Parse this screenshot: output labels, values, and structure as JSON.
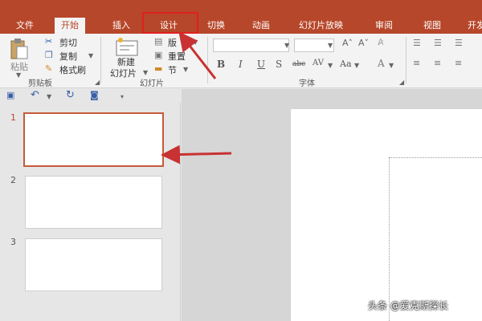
{
  "tabs": [
    {
      "label": "文件"
    },
    {
      "label": "开始"
    },
    {
      "label": "插入"
    },
    {
      "label": "设计"
    },
    {
      "label": "切换"
    },
    {
      "label": "动画"
    },
    {
      "label": "幻灯片放映"
    },
    {
      "label": "审阅"
    },
    {
      "label": "视图"
    },
    {
      "label": "开发"
    }
  ],
  "active_tab": "开始",
  "highlighted_tab": "设计",
  "clipboard": {
    "paste_label": "粘贴",
    "cut_label": "剪切",
    "copy_label": "复制",
    "format_painter_label": "格式刷",
    "group_label": "剪贴板"
  },
  "slides_group": {
    "new_slide_label_line1": "新建",
    "new_slide_label_line2": "幻灯片",
    "layout_label": "版",
    "reset_label": "重置",
    "section_label": "节",
    "group_label": "幻灯片"
  },
  "font_group": {
    "bold": "B",
    "italic": "I",
    "underline": "U",
    "shadow": "S",
    "strike": "abc",
    "spacing": "AV",
    "case": "Aa",
    "group_label": "字体"
  },
  "slides": [
    {
      "number": "1"
    },
    {
      "number": "2"
    },
    {
      "number": "3"
    }
  ],
  "watermark": "头条 @爱克斯探长",
  "colors": {
    "accent": "#b7472a",
    "highlight_box": "#e02020",
    "arrow": "#c83232"
  }
}
